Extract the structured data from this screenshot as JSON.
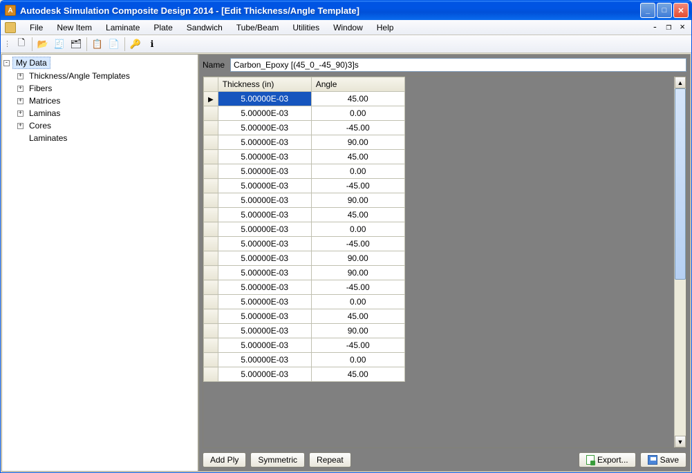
{
  "window": {
    "title": "Autodesk Simulation Composite Design 2014 - [Edit Thickness/Angle Template]"
  },
  "menu": {
    "items": [
      "File",
      "New Item",
      "Laminate",
      "Plate",
      "Sandwich",
      "Tube/Beam",
      "Utilities",
      "Window",
      "Help"
    ]
  },
  "toolbar": {
    "icons": [
      {
        "name": "new-doc-icon",
        "glyph": "🗋"
      },
      {
        "name": "open-folder-icon",
        "glyph": "📂"
      },
      {
        "name": "wizard-icon",
        "glyph": "🧾"
      },
      {
        "name": "tree-item-icon",
        "glyph": "🗂"
      },
      {
        "name": "copy-icon",
        "glyph": "📋"
      },
      {
        "name": "report-icon",
        "glyph": "📄"
      },
      {
        "name": "key-icon",
        "glyph": "🔑"
      },
      {
        "name": "info-icon",
        "glyph": "ℹ"
      }
    ]
  },
  "tree": {
    "root": "My Data",
    "children": [
      {
        "label": "Thickness/Angle Templates",
        "expandable": true
      },
      {
        "label": "Fibers",
        "expandable": true
      },
      {
        "label": "Matrices",
        "expandable": true
      },
      {
        "label": "Laminas",
        "expandable": true
      },
      {
        "label": "Cores",
        "expandable": true
      },
      {
        "label": "Laminates",
        "expandable": false
      }
    ]
  },
  "form": {
    "name_label": "Name",
    "name_value": "Carbon_Epoxy [(45_0_-45_90)3]s"
  },
  "grid": {
    "col_thickness": "Thickness (in)",
    "col_angle": "Angle",
    "selected_row": 0,
    "rows": [
      {
        "thickness": "5.00000E-03",
        "angle": "45.00"
      },
      {
        "thickness": "5.00000E-03",
        "angle": "0.00"
      },
      {
        "thickness": "5.00000E-03",
        "angle": "-45.00"
      },
      {
        "thickness": "5.00000E-03",
        "angle": "90.00"
      },
      {
        "thickness": "5.00000E-03",
        "angle": "45.00"
      },
      {
        "thickness": "5.00000E-03",
        "angle": "0.00"
      },
      {
        "thickness": "5.00000E-03",
        "angle": "-45.00"
      },
      {
        "thickness": "5.00000E-03",
        "angle": "90.00"
      },
      {
        "thickness": "5.00000E-03",
        "angle": "45.00"
      },
      {
        "thickness": "5.00000E-03",
        "angle": "0.00"
      },
      {
        "thickness": "5.00000E-03",
        "angle": "-45.00"
      },
      {
        "thickness": "5.00000E-03",
        "angle": "90.00"
      },
      {
        "thickness": "5.00000E-03",
        "angle": "90.00"
      },
      {
        "thickness": "5.00000E-03",
        "angle": "-45.00"
      },
      {
        "thickness": "5.00000E-03",
        "angle": "0.00"
      },
      {
        "thickness": "5.00000E-03",
        "angle": "45.00"
      },
      {
        "thickness": "5.00000E-03",
        "angle": "90.00"
      },
      {
        "thickness": "5.00000E-03",
        "angle": "-45.00"
      },
      {
        "thickness": "5.00000E-03",
        "angle": "0.00"
      },
      {
        "thickness": "5.00000E-03",
        "angle": "45.00"
      }
    ]
  },
  "buttons": {
    "add_ply": "Add Ply",
    "symmetric": "Symmetric",
    "repeat": "Repeat",
    "export": "Export...",
    "save": "Save"
  }
}
